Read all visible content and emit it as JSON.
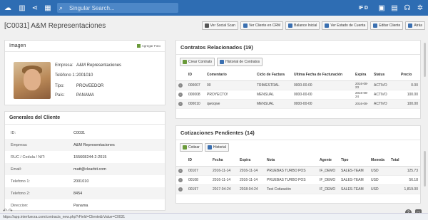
{
  "topbar": {
    "search_placeholder": "Singular Search...",
    "user": "IF D",
    "icons": [
      "cloud-icon",
      "building-icon",
      "share-icon",
      "grid-icon",
      "search-icon",
      "calendar-icon",
      "chart-icon",
      "headset-icon",
      "gear-icon"
    ]
  },
  "header": {
    "title": "[C0031] A&M Representaciones"
  },
  "actions": [
    {
      "label": "Ver Social Scan",
      "color": "#555"
    },
    {
      "label": "Ver Cliente en CRM",
      "color": "#3a6fb0"
    },
    {
      "label": "Balance Inicial",
      "color": "#3a6fb0"
    },
    {
      "label": "Ver Estado de Cuenta",
      "color": "#3a6fb0"
    },
    {
      "label": "Editar Cliente",
      "color": "#3a6fb0"
    },
    {
      "label": "Atrás",
      "color": "#3a6fb0"
    }
  ],
  "imagen": {
    "title": "Imagen",
    "add_photo": "Agregar Foto",
    "fields": [
      {
        "k": "Empresa:",
        "v": "A&M Representaciones"
      },
      {
        "k": "Teléfono 1:",
        "v": "2001010"
      },
      {
        "k": "Tipo:",
        "v": "PROVEEDOR"
      },
      {
        "k": "País:",
        "v": "PANAMA"
      }
    ]
  },
  "generales": {
    "title": "Generales del Cliente",
    "rows": [
      {
        "k": "ID:",
        "v": "C0031"
      },
      {
        "k": "Empresa:",
        "v": "A&M Representaciones"
      },
      {
        "k": "RUC / Cedula / NIT:",
        "v": "155608244-2-2015"
      },
      {
        "k": "Email:",
        "v": "matt@clearbit.com"
      },
      {
        "k": "Telefono 1:",
        "v": "2001010"
      },
      {
        "k": "Telefono 2:",
        "v": "8454"
      },
      {
        "k": "Direccion:",
        "v": "Panama"
      }
    ]
  },
  "contratos": {
    "title": "Contratos Relacionados (19)",
    "btn_crear": "Crear Contrato",
    "btn_historial": "Historial de Contratos",
    "headers": [
      "",
      "ID",
      "Comentario",
      "Ciclo de Factura",
      "Ultima Fecha de Facturación",
      "Expira",
      "Status",
      "Precio"
    ],
    "rows": [
      [
        "000007",
        "00",
        "TRIMESTRAL",
        "0000-00-00",
        "2016-08-23",
        "ACTIVO",
        "0.00"
      ],
      [
        "000008",
        "PROYECTO!",
        "MENSUAL",
        "0000-00-00",
        "2016-08-24",
        "ACTIVO",
        "100.00"
      ],
      [
        "000010",
        "qwoqwe",
        "MENSUAL",
        "0000-00-00",
        "2016-08-",
        "ACTIVO",
        "100.00"
      ]
    ]
  },
  "cotizaciones": {
    "title": "Cotizaciones Pendientes (14)",
    "btn_cotizar": "Cotizar",
    "btn_historial": "Historial",
    "headers": [
      "",
      "ID",
      "Fecha",
      "Expira",
      "Nota",
      "Agente",
      "Tipo",
      "Moneda",
      "Total"
    ],
    "rows": [
      [
        "00107",
        "2016-11-14",
        "2016-11-14",
        "PRUEBAS TURBO POS",
        "IF_DEMO",
        "SALES-TEAM",
        "USD",
        "125.73"
      ],
      [
        "00108",
        "2016-11-14",
        "2016-11-14",
        "PRUEBAS TURBO POS",
        "IF_DEMO",
        "SALES-TEAM",
        "USD",
        "56.18"
      ],
      [
        "00197",
        "2017-04-24",
        "2018-04-24",
        "Test Cotización",
        "IF_DEMO",
        "SALES-TEAM",
        "USD",
        "1,819.00"
      ]
    ]
  },
  "status_url": "https://app.interfuerza.com/contracts_new.php?rField=Cliente&rValue=C0031"
}
